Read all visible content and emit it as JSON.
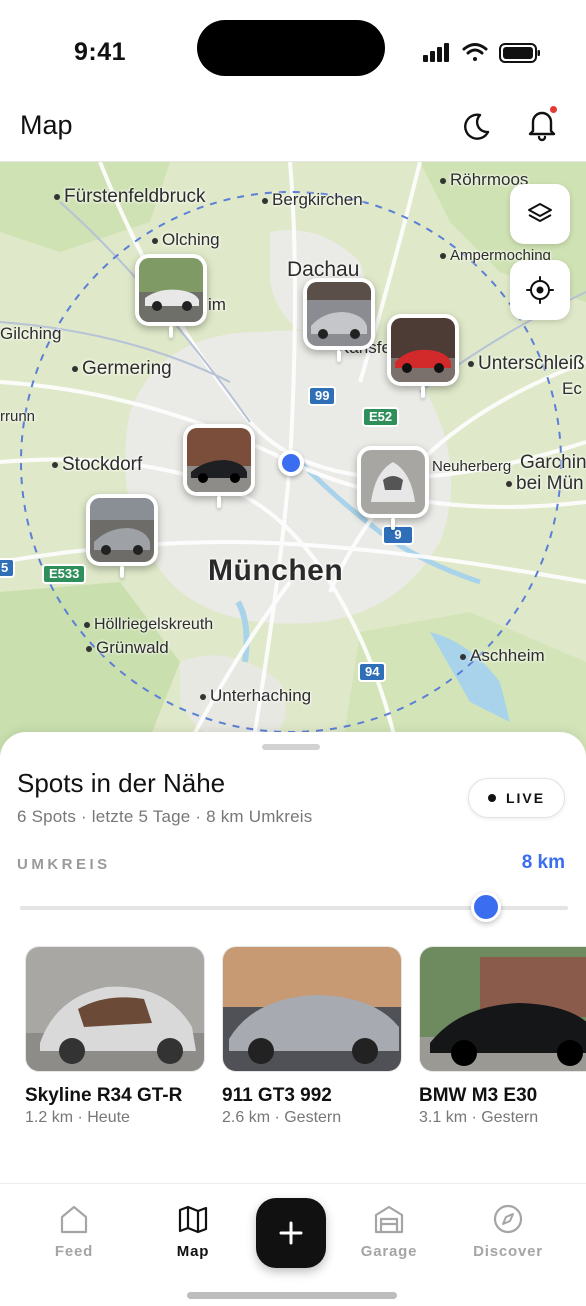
{
  "status_bar": {
    "time": "9:41"
  },
  "header": {
    "title": "Map",
    "moon_icon": "moon-icon",
    "bell_icon": "bell-icon",
    "notification_dot_color": "#e53935"
  },
  "map": {
    "places": {
      "fuerstenfeldbruck": "Fürstenfeldbruck",
      "bergkirchen": "Bergkirchen",
      "roehrmoos": "Röhrmoos",
      "olching": "Olching",
      "dachau": "Dachau",
      "ampermoching": "Ampermoching",
      "gilching": "Gilching",
      "germering": "Germering",
      "karlsfeld": "Karlsfeld",
      "unterschleissheim": "Unterschleiß",
      "ec": "Ec",
      "krailling": "rrunn",
      "stockdorf": "Stockdorf",
      "neuherberg": "Neuherberg",
      "garching": "Garching",
      "garching2": "bei Mün",
      "muenchen": "München",
      "hoellriegelskreuth": "Höllriegelskreuth",
      "gruenwald": "Grünwald",
      "aschheim": "Aschheim",
      "unterhaching": "Unterhaching",
      "im": "im"
    },
    "shields": {
      "r99": "99",
      "e52": "E52",
      "r9": "9",
      "e533": "E533",
      "r5": "5",
      "r94": "94"
    },
    "layers_icon": "layers-icon",
    "locate_icon": "crosshair-icon"
  },
  "sheet": {
    "title": "Spots in der Nähe",
    "subtitle": "6 Spots · letzte 5 Tage · 8 km Umkreis",
    "live_label": "LIVE",
    "radius_label": "UMKREIS",
    "radius_value": "8 km",
    "radius_fraction": 0.85,
    "cards": [
      {
        "name": "Skyline R34 GT-R",
        "meta": "1.2 km · Heute"
      },
      {
        "name": "911 GT3 992",
        "meta": "2.6 km · Gestern"
      },
      {
        "name": "BMW M3 E30",
        "meta": "3.1 km · Gestern"
      }
    ]
  },
  "tabbar": {
    "tabs": [
      {
        "label": "Feed",
        "icon": "home-icon"
      },
      {
        "label": "Map",
        "icon": "map-icon"
      },
      {
        "label": "Garage",
        "icon": "garage-icon"
      },
      {
        "label": "Discover",
        "icon": "compass-icon"
      }
    ],
    "fab_icon": "plus-icon"
  },
  "colors": {
    "accent": "#3b6df0",
    "map_land": "#dfe9c9",
    "map_urban": "#ececec",
    "water": "#a9d3ea"
  }
}
